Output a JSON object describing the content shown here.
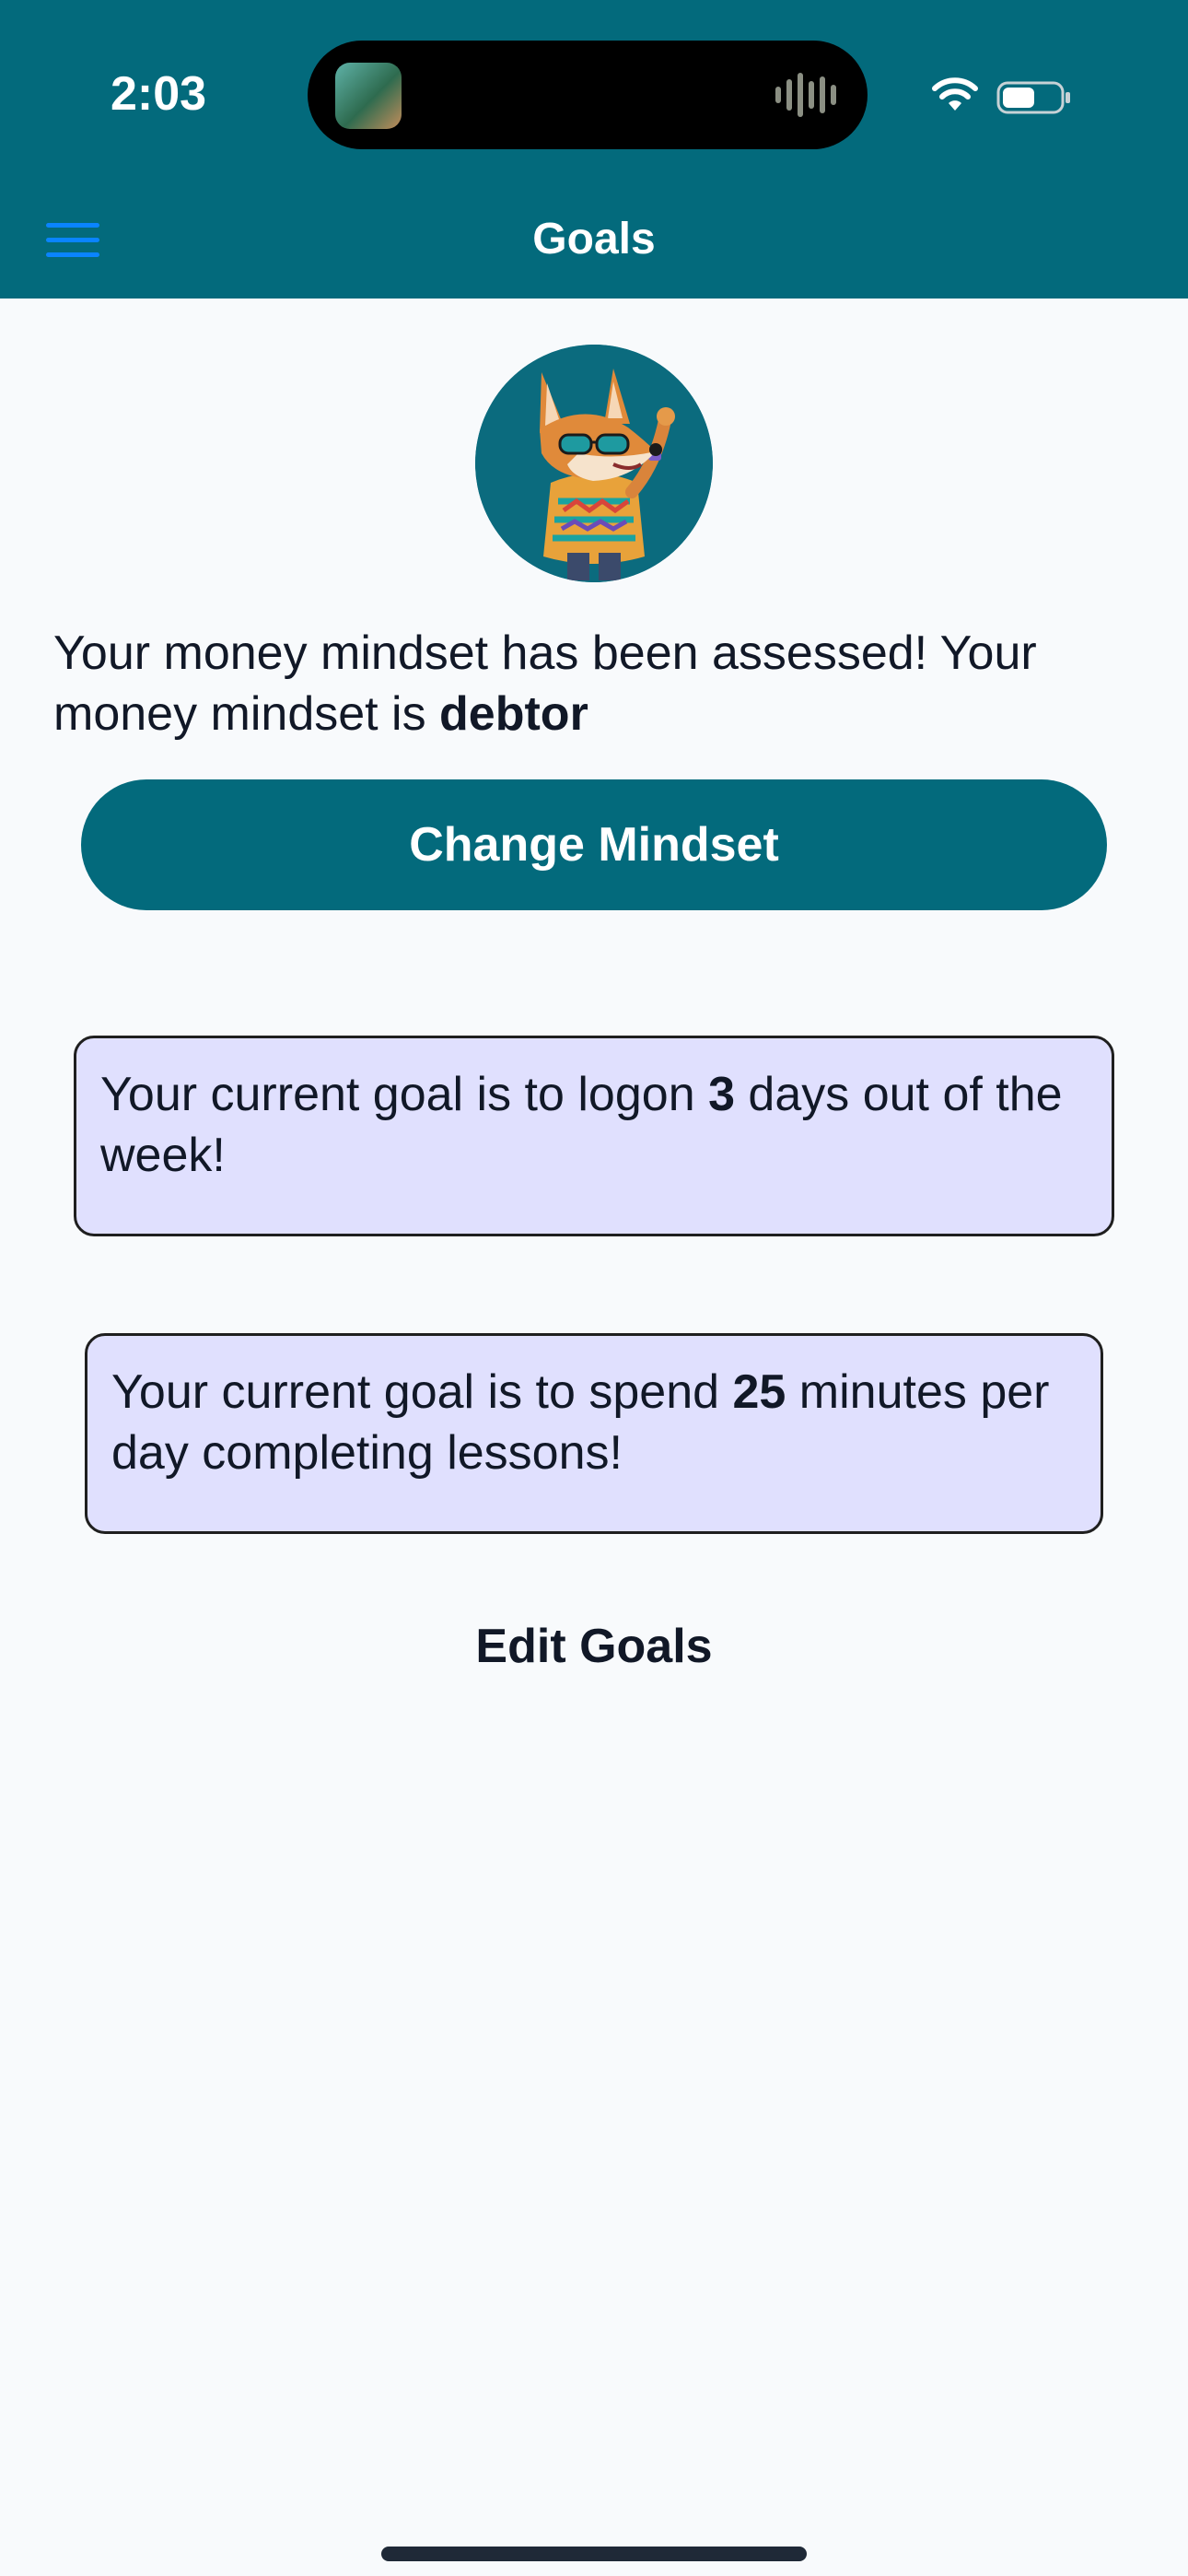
{
  "status_bar": {
    "time": "2:03"
  },
  "header": {
    "title": "Goals",
    "menu_icon": "hamburger-menu-icon"
  },
  "mindset": {
    "message_prefix": "Your money mindset has been assessed! Your money mindset is ",
    "mindset_value": "debtor",
    "change_button_label": "Change Mindset"
  },
  "goals": {
    "logon_prefix": "Your current goal is to logon ",
    "logon_days": "3",
    "logon_suffix": " days out of the week!",
    "lesson_prefix": "Your current goal is to spend ",
    "lesson_minutes": "25",
    "lesson_suffix": " minutes per day completing lessons!",
    "edit_label": "Edit Goals"
  },
  "colors": {
    "header_bg": "#036a7c",
    "menu_icon": "#0a84ff",
    "card_bg": "#e0e0fe",
    "page_bg": "#f8fafc"
  }
}
